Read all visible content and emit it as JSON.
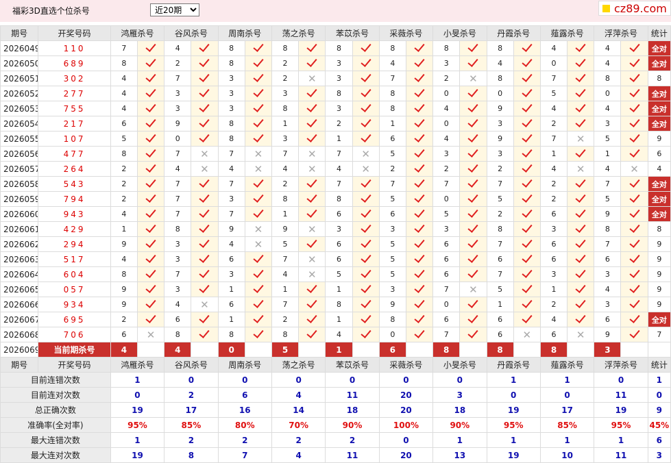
{
  "title": "福彩3D直选个位杀号",
  "period_select": {
    "selected": "近20期",
    "options": [
      "近20期"
    ]
  },
  "logo": {
    "text": "cz89.com"
  },
  "header": {
    "issue": "期号",
    "kaijiang": "开奖号码",
    "experts": [
      "鸿雁杀号",
      "谷风杀号",
      "周南杀号",
      "荡之杀号",
      "苯苡杀号",
      "采薇杀号",
      "小旻杀号",
      "丹霞杀号",
      "薤露杀号",
      "浮萍杀号"
    ],
    "stat": "统计"
  },
  "rows": [
    {
      "issue": "2026049",
      "kj": "110",
      "vals": [
        "7",
        "4",
        "8",
        "8",
        "8",
        "8",
        "8",
        "8",
        "4",
        "4"
      ],
      "ok": [
        1,
        1,
        1,
        1,
        1,
        1,
        1,
        1,
        1,
        1
      ],
      "stat": "全对"
    },
    {
      "issue": "2026050",
      "kj": "689",
      "vals": [
        "8",
        "2",
        "8",
        "2",
        "3",
        "4",
        "3",
        "4",
        "0",
        "4"
      ],
      "ok": [
        1,
        1,
        1,
        1,
        1,
        1,
        1,
        1,
        1,
        1
      ],
      "stat": "全对"
    },
    {
      "issue": "2026051",
      "kj": "302",
      "vals": [
        "4",
        "7",
        "3",
        "2",
        "3",
        "7",
        "2",
        "8",
        "7",
        "8"
      ],
      "ok": [
        1,
        1,
        1,
        0,
        1,
        1,
        0,
        1,
        1,
        1
      ],
      "stat": "8"
    },
    {
      "issue": "2026052",
      "kj": "277",
      "vals": [
        "4",
        "3",
        "3",
        "3",
        "8",
        "8",
        "0",
        "0",
        "5",
        "0"
      ],
      "ok": [
        1,
        1,
        1,
        1,
        1,
        1,
        1,
        1,
        1,
        1
      ],
      "stat": "全对"
    },
    {
      "issue": "2026053",
      "kj": "755",
      "vals": [
        "4",
        "3",
        "3",
        "8",
        "3",
        "8",
        "4",
        "9",
        "4",
        "4"
      ],
      "ok": [
        1,
        1,
        1,
        1,
        1,
        1,
        1,
        1,
        1,
        1
      ],
      "stat": "全对"
    },
    {
      "issue": "2026054",
      "kj": "217",
      "vals": [
        "6",
        "9",
        "8",
        "1",
        "2",
        "1",
        "0",
        "3",
        "2",
        "3"
      ],
      "ok": [
        1,
        1,
        1,
        1,
        1,
        1,
        1,
        1,
        1,
        1
      ],
      "stat": "全对"
    },
    {
      "issue": "2026055",
      "kj": "107",
      "vals": [
        "5",
        "0",
        "8",
        "3",
        "1",
        "6",
        "4",
        "9",
        "7",
        "5"
      ],
      "ok": [
        1,
        1,
        1,
        1,
        1,
        1,
        1,
        1,
        0,
        1
      ],
      "stat": "9"
    },
    {
      "issue": "2026056",
      "kj": "477",
      "vals": [
        "8",
        "7",
        "7",
        "7",
        "7",
        "5",
        "3",
        "3",
        "1",
        "1"
      ],
      "ok": [
        1,
        0,
        0,
        0,
        0,
        1,
        1,
        1,
        1,
        1
      ],
      "stat": "6"
    },
    {
      "issue": "2026057",
      "kj": "264",
      "vals": [
        "2",
        "4",
        "4",
        "4",
        "4",
        "2",
        "2",
        "2",
        "4",
        "4"
      ],
      "ok": [
        1,
        0,
        0,
        0,
        0,
        1,
        1,
        1,
        0,
        0
      ],
      "stat": "4"
    },
    {
      "issue": "2026058",
      "kj": "543",
      "vals": [
        "2",
        "7",
        "7",
        "2",
        "7",
        "7",
        "7",
        "7",
        "2",
        "7"
      ],
      "ok": [
        1,
        1,
        1,
        1,
        1,
        1,
        1,
        1,
        1,
        1
      ],
      "stat": "全对"
    },
    {
      "issue": "2026059",
      "kj": "794",
      "vals": [
        "2",
        "7",
        "3",
        "8",
        "8",
        "5",
        "0",
        "5",
        "2",
        "5"
      ],
      "ok": [
        1,
        1,
        1,
        1,
        1,
        1,
        1,
        1,
        1,
        1
      ],
      "stat": "全对"
    },
    {
      "issue": "2026060",
      "kj": "943",
      "vals": [
        "4",
        "7",
        "7",
        "1",
        "6",
        "6",
        "5",
        "2",
        "6",
        "9"
      ],
      "ok": [
        1,
        1,
        1,
        1,
        1,
        1,
        1,
        1,
        1,
        1
      ],
      "stat": "全对"
    },
    {
      "issue": "2026061",
      "kj": "429",
      "vals": [
        "1",
        "8",
        "9",
        "9",
        "3",
        "3",
        "3",
        "8",
        "3",
        "8"
      ],
      "ok": [
        1,
        1,
        0,
        0,
        1,
        1,
        1,
        1,
        1,
        1
      ],
      "stat": "8"
    },
    {
      "issue": "2026062",
      "kj": "294",
      "vals": [
        "9",
        "3",
        "4",
        "5",
        "6",
        "5",
        "6",
        "7",
        "6",
        "7"
      ],
      "ok": [
        1,
        1,
        0,
        1,
        1,
        1,
        1,
        1,
        1,
        1
      ],
      "stat": "9"
    },
    {
      "issue": "2026063",
      "kj": "517",
      "vals": [
        "4",
        "3",
        "6",
        "7",
        "6",
        "5",
        "6",
        "6",
        "6",
        "6"
      ],
      "ok": [
        1,
        1,
        1,
        0,
        1,
        1,
        1,
        1,
        1,
        1
      ],
      "stat": "9"
    },
    {
      "issue": "2026064",
      "kj": "604",
      "vals": [
        "8",
        "7",
        "3",
        "4",
        "5",
        "5",
        "6",
        "7",
        "3",
        "3"
      ],
      "ok": [
        1,
        1,
        1,
        0,
        1,
        1,
        1,
        1,
        1,
        1
      ],
      "stat": "9"
    },
    {
      "issue": "2026065",
      "kj": "057",
      "vals": [
        "9",
        "3",
        "1",
        "1",
        "1",
        "3",
        "7",
        "5",
        "1",
        "4"
      ],
      "ok": [
        1,
        1,
        1,
        1,
        1,
        1,
        0,
        1,
        1,
        1
      ],
      "stat": "9"
    },
    {
      "issue": "2026066",
      "kj": "934",
      "vals": [
        "9",
        "4",
        "6",
        "7",
        "8",
        "9",
        "0",
        "1",
        "2",
        "3"
      ],
      "ok": [
        1,
        0,
        1,
        1,
        1,
        1,
        1,
        1,
        1,
        1
      ],
      "stat": "9"
    },
    {
      "issue": "2026067",
      "kj": "695",
      "vals": [
        "2",
        "6",
        "1",
        "2",
        "1",
        "8",
        "6",
        "6",
        "4",
        "6"
      ],
      "ok": [
        1,
        1,
        1,
        1,
        1,
        1,
        1,
        1,
        1,
        1
      ],
      "stat": "全对"
    },
    {
      "issue": "2026068",
      "kj": "706",
      "vals": [
        "6",
        "8",
        "8",
        "8",
        "4",
        "0",
        "7",
        "6",
        "6",
        "9"
      ],
      "ok": [
        0,
        1,
        1,
        1,
        1,
        1,
        1,
        0,
        0,
        1
      ],
      "stat": "7"
    }
  ],
  "current": {
    "issue": "2026069",
    "label": "当前期杀号",
    "vals": [
      "4",
      "4",
      "0",
      "5",
      "1",
      "6",
      "8",
      "8",
      "8",
      "3"
    ]
  },
  "stats": [
    {
      "label": "目前连错次数",
      "vals": [
        "1",
        "0",
        "0",
        "0",
        "0",
        "0",
        "0",
        "1",
        "1",
        "0"
      ],
      "total": "1"
    },
    {
      "label": "目前连对次数",
      "vals": [
        "0",
        "2",
        "6",
        "4",
        "11",
        "20",
        "3",
        "0",
        "0",
        "11"
      ],
      "total": "0"
    },
    {
      "label": "总正确次数",
      "vals": [
        "19",
        "17",
        "16",
        "14",
        "18",
        "20",
        "18",
        "19",
        "17",
        "19"
      ],
      "total": "9"
    },
    {
      "label": "准确率(全对率)",
      "vals": [
        "95%",
        "85%",
        "80%",
        "70%",
        "90%",
        "100%",
        "90%",
        "95%",
        "85%",
        "95%"
      ],
      "total": "45%"
    },
    {
      "label": "最大连错次数",
      "vals": [
        "1",
        "2",
        "2",
        "2",
        "2",
        "0",
        "1",
        "1",
        "1",
        "1"
      ],
      "total": "6"
    },
    {
      "label": "最大连对次数",
      "vals": [
        "19",
        "8",
        "7",
        "4",
        "11",
        "20",
        "13",
        "19",
        "10",
        "11"
      ],
      "total": "3"
    }
  ]
}
